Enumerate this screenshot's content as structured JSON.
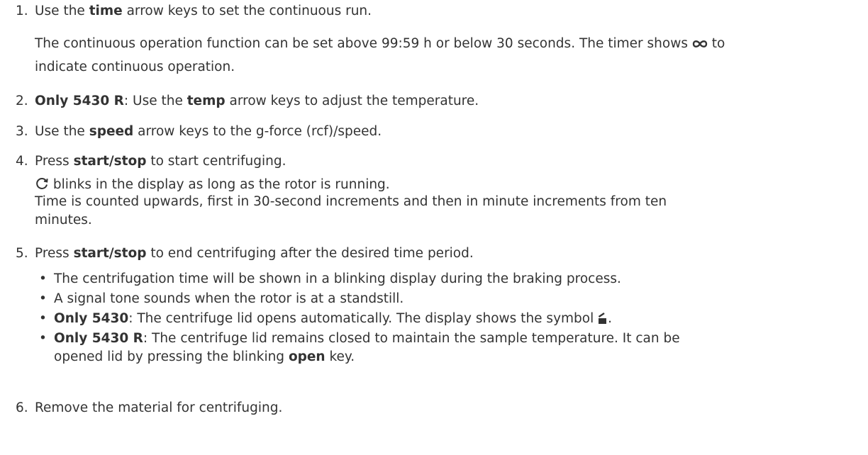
{
  "steps": [
    {
      "number": "1.",
      "line1": {
        "pre": "Use the ",
        "bold": "time",
        "post": " arrow keys to set the continuous run."
      },
      "note": {
        "line1_pre": "The continuous operation function can be set above 99:59 h or below 30 seconds. The timer shows ",
        "symbol": "infinity-icon",
        "line1_post": " to",
        "line2": "indicate continuous operation."
      }
    },
    {
      "number": "2.",
      "bold1": "Only 5430 R",
      "mid": ": Use the ",
      "bold2": "temp",
      "post": " arrow keys to adjust the temperature."
    },
    {
      "number": "3.",
      "pre": "Use the ",
      "bold": "speed",
      "post": " arrow keys to the g-force (rcf)/speed."
    },
    {
      "number": "4.",
      "pre": "Press ",
      "bold": "start/stop",
      "post": " to start centrifuging.",
      "result": {
        "symbol": "rotation-icon",
        "line1": " blinks in the display as long as the rotor is running.",
        "line2": "Time is counted upwards, first in 30-second increments and then in minute increments from ten",
        "line3": "minutes."
      }
    },
    {
      "number": "5.",
      "pre": "Press ",
      "bold": "start/stop",
      "post": " to end centrifuging after the desired time period.",
      "bullets": [
        {
          "text": "The centrifugation time will be shown in a blinking display during the braking process."
        },
        {
          "text": "A signal tone sounds when the rotor is at a standstill."
        },
        {
          "bold": "Only 5430",
          "text": ": The centrifuge lid opens automatically. The display shows the symbol ",
          "symbol": "lid-open-icon",
          "after": "."
        },
        {
          "bold": "Only 5430 R",
          "text": ": The centrifuge lid remains closed to maintain the sample temperature. It can be",
          "line2_pre": "opened lid by pressing the blinking ",
          "line2_bold": "open",
          "line2_post": " key."
        }
      ]
    },
    {
      "number": "6.",
      "text": "Remove the material for centrifuging."
    }
  ]
}
